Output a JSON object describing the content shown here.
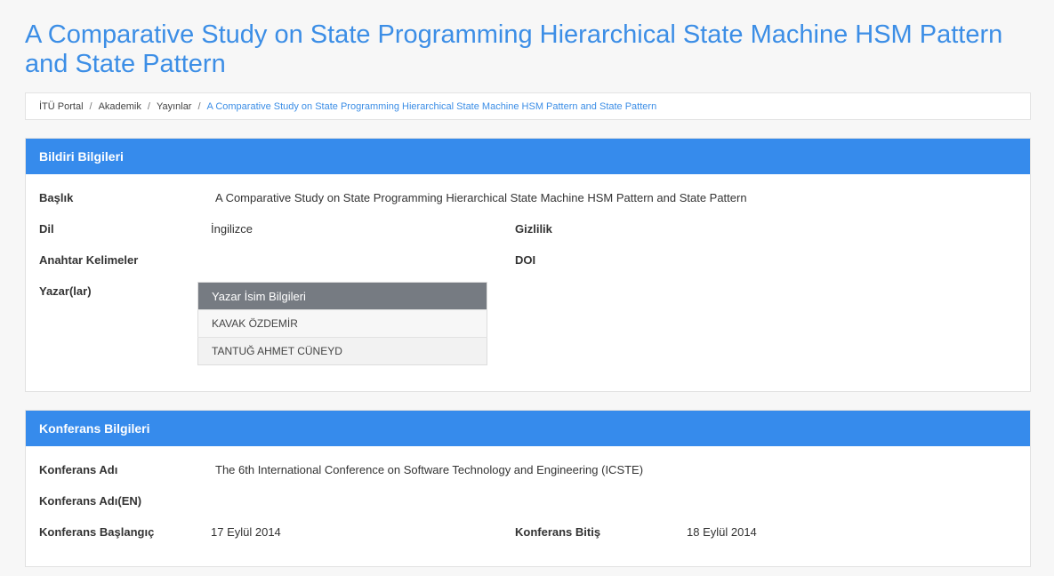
{
  "page": {
    "title": "A Comparative Study on State Programming Hierarchical State Machine HSM Pattern and State Pattern"
  },
  "breadcrumb": [
    {
      "label": "İTÜ Portal"
    },
    {
      "label": "Akademik"
    },
    {
      "label": "Yayınlar"
    },
    {
      "label": "A Comparative Study on State Programming Hierarchical State Machine HSM Pattern and State Pattern"
    }
  ],
  "bildiri": {
    "header": "Bildiri Bilgileri",
    "baslik_label": "Başlık",
    "baslik_value": "A Comparative Study on State Programming Hierarchical State Machine HSM Pattern and State Pattern",
    "dil_label": "Dil",
    "dil_value": "İngilizce",
    "gizlilik_label": "Gizlilik",
    "anahtar_label": "Anahtar Kelimeler",
    "doi_label": "DOI",
    "yazar_label": "Yazar(lar)",
    "authors_header": "Yazar İsim Bilgileri",
    "authors": [
      "KAVAK ÖZDEMİR",
      "TANTUĞ AHMET CÜNEYD"
    ]
  },
  "konferans": {
    "header": "Konferans Bilgileri",
    "adi_label": "Konferans Adı",
    "adi_value": "The 6th International Conference on Software Technology and Engineering (ICSTE)",
    "adi_en_label": "Konferans Adı(EN)",
    "baslangic_label": "Konferans Başlangıç",
    "baslangic_value": "17 Eylül 2014",
    "bitis_label": "Konferans Bitiş",
    "bitis_value": "18 Eylül 2014"
  },
  "colors": {
    "accent": "#368bec",
    "title": "#3c8ee6",
    "table_header": "#767b82"
  }
}
